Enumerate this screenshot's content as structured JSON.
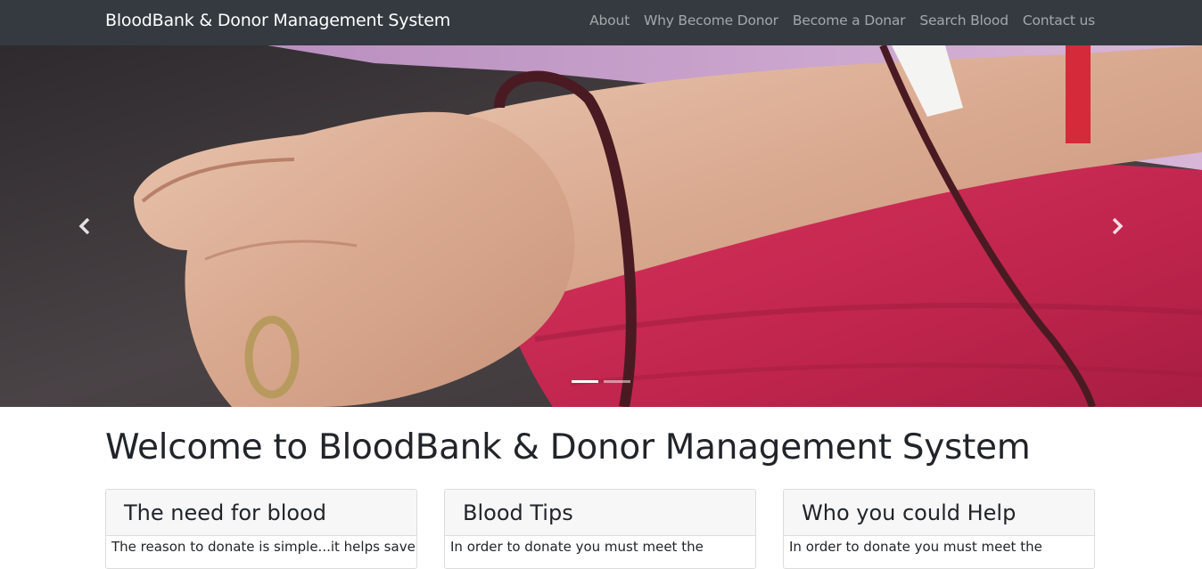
{
  "navbar": {
    "brand": "BloodBank & Donor Management System",
    "links": [
      "About",
      "Why Become Donor",
      "Become a Donar",
      "Search Blood",
      "Contact us"
    ],
    "background": "#343a40"
  },
  "carousel": {
    "prev_icon": "chevron-left-icon",
    "next_icon": "chevron-right-icon",
    "slide_count": 2,
    "active_slide": 1
  },
  "main": {
    "welcome_heading": "Welcome to BloodBank & Donor Management System",
    "cards": [
      {
        "title": "The need for blood",
        "text": "The reason to donate is simple...it helps save"
      },
      {
        "title": "Blood Tips",
        "text": "In order to donate you must meet the"
      },
      {
        "title": "Who you could Help",
        "text": "In order to donate you must meet the"
      }
    ]
  }
}
